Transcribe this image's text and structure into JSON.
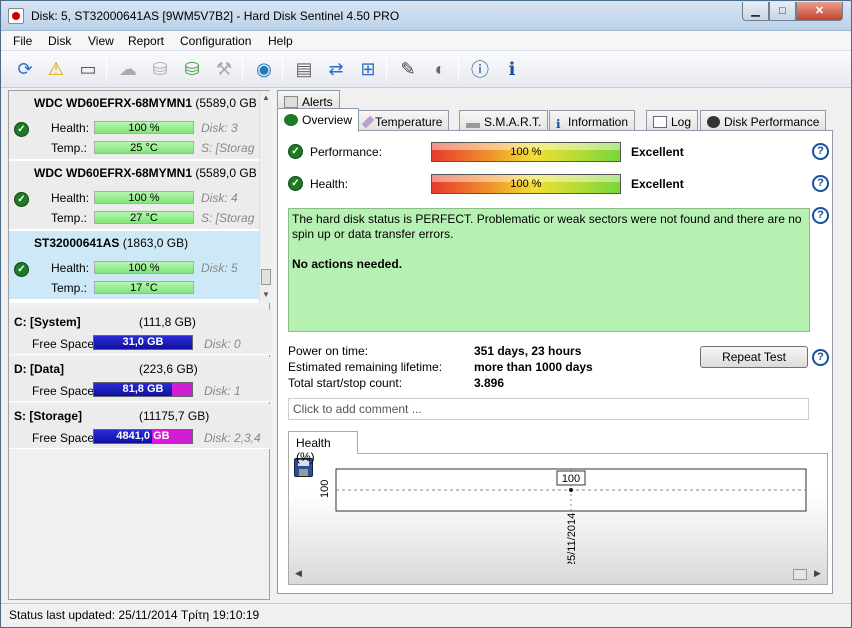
{
  "window": {
    "title": "Disk: 5, ST32000641AS [9WM5V7B2]  -  Hard Disk Sentinel 4.50 PRO",
    "minimize": "▁",
    "maximize": "□",
    "close": "✕"
  },
  "menu": [
    "File",
    "Disk",
    "View",
    "Report",
    "Configuration",
    "Help"
  ],
  "toolbar_icons": [
    "refresh-icon",
    "alert-icon",
    "disk-icon",
    "cloud-icon",
    "disk-test-icon",
    "disk-ok-icon",
    "disk-wipe-icon",
    "globe-icon",
    "report-icon",
    "sync-icon",
    "network-icon",
    "settings-icon",
    "speaker-icon",
    "help-icon",
    "info-icon"
  ],
  "disks": [
    {
      "name": "WDC WD60EFRX-68MYMN1",
      "size": "(5589,0 GB",
      "health_label": "Health:",
      "health": "100 %",
      "health_pct": 100,
      "disk_ref": "Disk: 3",
      "temp_label": "Temp.:",
      "temp": "25 °C",
      "vol_ref": "S: [Storag"
    },
    {
      "name": "WDC WD60EFRX-68MYMN1",
      "size": "(5589,0 GB",
      "health_label": "Health:",
      "health": "100 %",
      "health_pct": 100,
      "disk_ref": "Disk: 4",
      "temp_label": "Temp.:",
      "temp": "27 °C",
      "vol_ref": "S: [Storag"
    },
    {
      "name": "ST32000641AS",
      "size": "(1863,0 GB)",
      "health_label": "Health:",
      "health": "100 %",
      "health_pct": 100,
      "disk_ref": "Disk: 5",
      "temp_label": "Temp.:",
      "temp": "17 °C",
      "vol_ref": ""
    }
  ],
  "volumes": [
    {
      "name": "C: [System]",
      "size": "(111,8 GB)",
      "free_label": "Free Space",
      "free": "31,0 GB",
      "free_pct": 100,
      "disk_ref": "Disk: 0"
    },
    {
      "name": "D: [Data]",
      "size": "(223,6 GB)",
      "free_label": "Free Space",
      "free": "81,8 GB",
      "free_pct": 80,
      "disk_ref": "Disk: 1"
    },
    {
      "name": "S: [Storage]",
      "size": "(11175,7 GB)",
      "free_label": "Free Space",
      "free": "4841,0 GB",
      "free_pct": 60,
      "disk_ref": "Disk: 2,3,4"
    }
  ],
  "tabs": {
    "alerts": "Alerts",
    "overview": "Overview",
    "temperature": "Temperature",
    "smart": "S.M.A.R.T.",
    "information": "Information",
    "log": "Log",
    "performance": "Disk Performance"
  },
  "overview": {
    "performance_label": "Performance:",
    "performance_value": "100 %",
    "performance_rating": "Excellent",
    "health_label": "Health:",
    "health_value": "100 %",
    "health_rating": "Excellent",
    "status_line1": "The hard disk status is PERFECT. Problematic or weak sectors were not found and there are no spin up or data transfer errors.",
    "status_line2": "No actions needed.",
    "power_on_label": "Power on time:",
    "power_on_value": "351 days, 23 hours",
    "lifetime_label": "Estimated remaining lifetime:",
    "lifetime_value": "more than 1000 days",
    "startstop_label": "Total start/stop count:",
    "startstop_value": "3.896",
    "repeat_button": "Repeat Test",
    "comment_placeholder": "Click to add comment ...",
    "help": "?"
  },
  "chart_data": {
    "type": "line",
    "title": "Health (%)",
    "x": [
      "25/11/2014"
    ],
    "series": [
      {
        "values": [
          100
        ]
      }
    ],
    "ylabel": "",
    "y_tick_labels": [
      "100"
    ],
    "data_labels": [
      "100"
    ],
    "grid": true
  },
  "statusbar": {
    "text": "Status last updated: 25/11/2014 Τρίτη 19:10:19"
  }
}
